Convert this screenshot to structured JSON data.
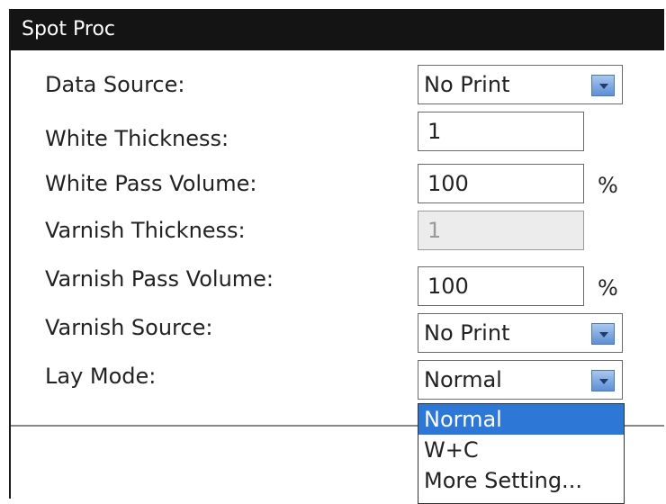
{
  "panel": {
    "title": "Spot Proc"
  },
  "fields": {
    "data_source": {
      "label": "Data Source:",
      "value": "No Print"
    },
    "white_thickness": {
      "label": "White Thickness:",
      "value": "1"
    },
    "white_pass_volume": {
      "label": "White Pass Volume:",
      "value": "100",
      "unit": "%"
    },
    "varnish_thickness": {
      "label": "Varnish Thickness:",
      "value": "1"
    },
    "varnish_pass_volume": {
      "label": "Varnish Pass Volume:",
      "value": "100",
      "unit": "%"
    },
    "varnish_source": {
      "label": "Varnish Source:",
      "value": "No Print"
    },
    "lay_mode": {
      "label": "Lay Mode:",
      "value": "Normal"
    }
  },
  "lay_mode_dropdown": {
    "options": [
      "Normal",
      "W+C",
      "More Setting..."
    ],
    "highlighted": "Normal"
  },
  "colors": {
    "title_bg": "#141414",
    "highlight": "#2d78d6",
    "disabled_bg": "#ececec"
  }
}
